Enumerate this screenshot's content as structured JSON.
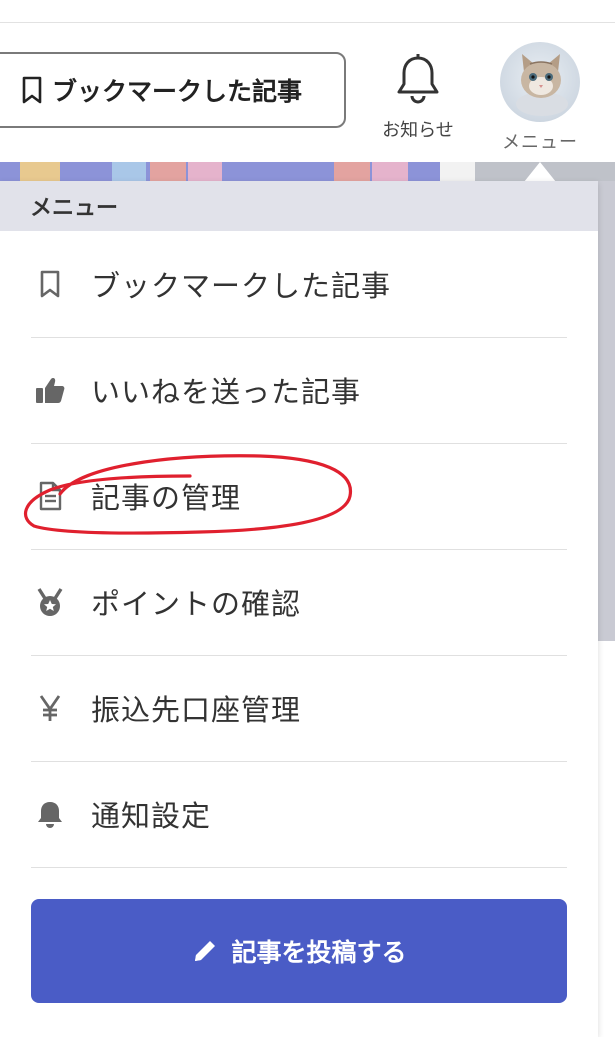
{
  "header": {
    "bookmark_button": "ブックマークした記事",
    "notifications_label": "お知らせ",
    "menu_label": "メニュー",
    "avatar_icon": "cat-avatar-icon"
  },
  "menu": {
    "title": "メニュー",
    "items": [
      {
        "label": "ブックマークした記事",
        "icon": "bookmark-icon"
      },
      {
        "label": "いいねを送った記事",
        "icon": "thumbs-up-icon"
      },
      {
        "label": "記事の管理",
        "icon": "document-icon"
      },
      {
        "label": "ポイントの確認",
        "icon": "medal-icon"
      },
      {
        "label": "振込先口座管理",
        "icon": "yen-icon"
      },
      {
        "label": "通知設定",
        "icon": "bell-icon"
      }
    ],
    "post_button": "記事を投稿する"
  },
  "colors": {
    "accent": "#4a5cc6",
    "menu_header_bg": "#e1e2ea",
    "annotation": "#e0202e"
  }
}
